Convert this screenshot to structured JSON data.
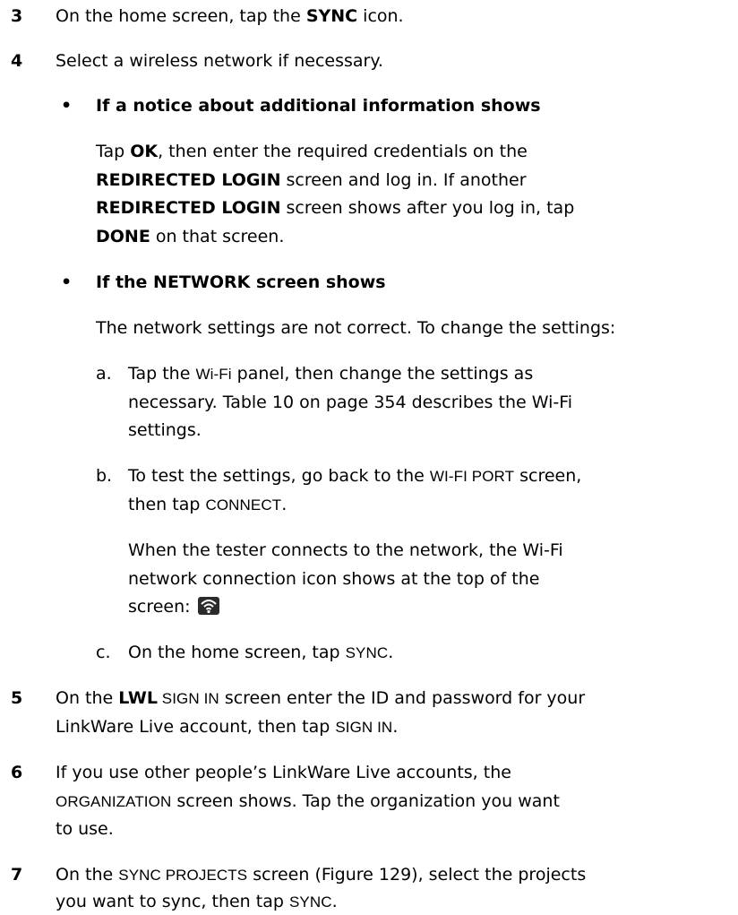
{
  "steps": [
    {
      "num": "3",
      "pre": "On the home screen, tap the ",
      "b1": "SYNC",
      "post": " icon."
    },
    {
      "num": "4",
      "text": "Select a wireless network if necessary."
    },
    {
      "num": "5",
      "pre": "On the ",
      "b1": "LWL",
      "ui1": " SIGN IN",
      "mid": " screen enter the ID and password for your",
      "line2pre": "LinkWare Live account, then tap ",
      "ui2": "SIGN IN",
      "end": "."
    },
    {
      "num": "6",
      "line1": "If you use other people’s LinkWare Live accounts, the",
      "ui1": "ORGANIZATION",
      "line2post": " screen shows. Tap the organization you want",
      "line3": "to use."
    },
    {
      "num": "7",
      "pre": "On the ",
      "ui1": "SYNC PROJECTS",
      "mid": " screen (Figure 129), select the projects",
      "line2pre": "you want to sync, then tap ",
      "ui2": "SYNC",
      "end": "."
    }
  ],
  "bullets": [
    {
      "mark": "•",
      "heading": "If a notice about additional information shows",
      "l1a": "Tap ",
      "l1b": "OK",
      "l1c": ", then enter the required credentials on the",
      "l2a": "REDIRECTED LOGIN",
      "l2b": " screen and log in. If another",
      "l3a": "REDIRECTED LOGIN",
      "l3b": " screen shows after you log in, tap",
      "l4a": "DONE",
      "l4b": " on that screen."
    },
    {
      "mark": "•",
      "heading": "If the NETWORK screen shows",
      "text": "The network settings are not correct. To change the settings:"
    }
  ],
  "substeps": [
    {
      "mark": "a.",
      "l1a": "Tap the ",
      "l1ui": "Wi-Fi",
      "l1b": " panel, then change the settings as",
      "l2": "necessary. Table 10 on page 354 describes the Wi-Fi",
      "l3": "settings."
    },
    {
      "mark": "b.",
      "l1a": "To test the settings, go back to the ",
      "l1ui": "WI-FI PORT",
      "l1b": " screen,",
      "l2a": "then tap ",
      "l2ui": "CONNECT",
      "l2b": ".",
      "p1": "When the tester connects to the network, the Wi-Fi",
      "p2": "network connection icon shows at the top of the",
      "p3": "screen: "
    },
    {
      "mark": "c.",
      "l1a": "On the home screen, tap ",
      "l1ui": "SYNC",
      "l1b": "."
    }
  ],
  "icons": {
    "wifi": "wifi-connection-icon"
  }
}
